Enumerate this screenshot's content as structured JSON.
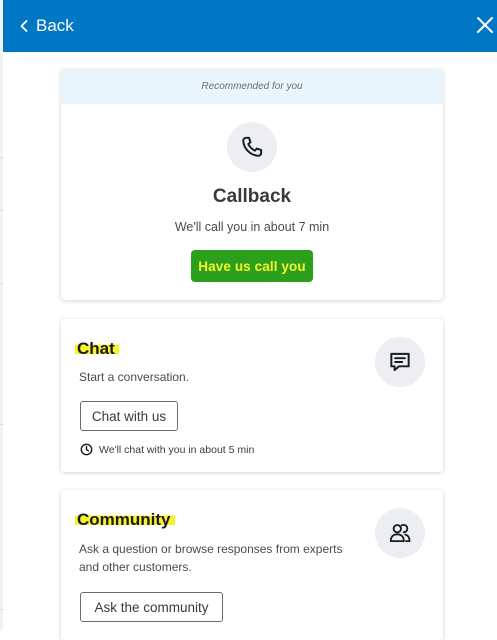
{
  "header": {
    "back_label": "Back",
    "background_color": "#0077c5"
  },
  "callback_card": {
    "banner": "Recommended for you",
    "title": "Callback",
    "subtitle": "We'll call you in about 7 min",
    "button_label": "Have us call you",
    "button_color": "#2ca01c",
    "icon": "phone-icon"
  },
  "chat_card": {
    "title": "Chat",
    "description": "Start a conversation.",
    "button_label": "Chat with us",
    "wait_text": "We'll chat with you in about 5 min",
    "icon": "chat-bubble-icon"
  },
  "community_card": {
    "title": "Community",
    "description_line1": "Ask a question or browse responses from experts",
    "description_line2": "and other customers.",
    "button_label": "Ask the community",
    "icon": "users-icon"
  }
}
